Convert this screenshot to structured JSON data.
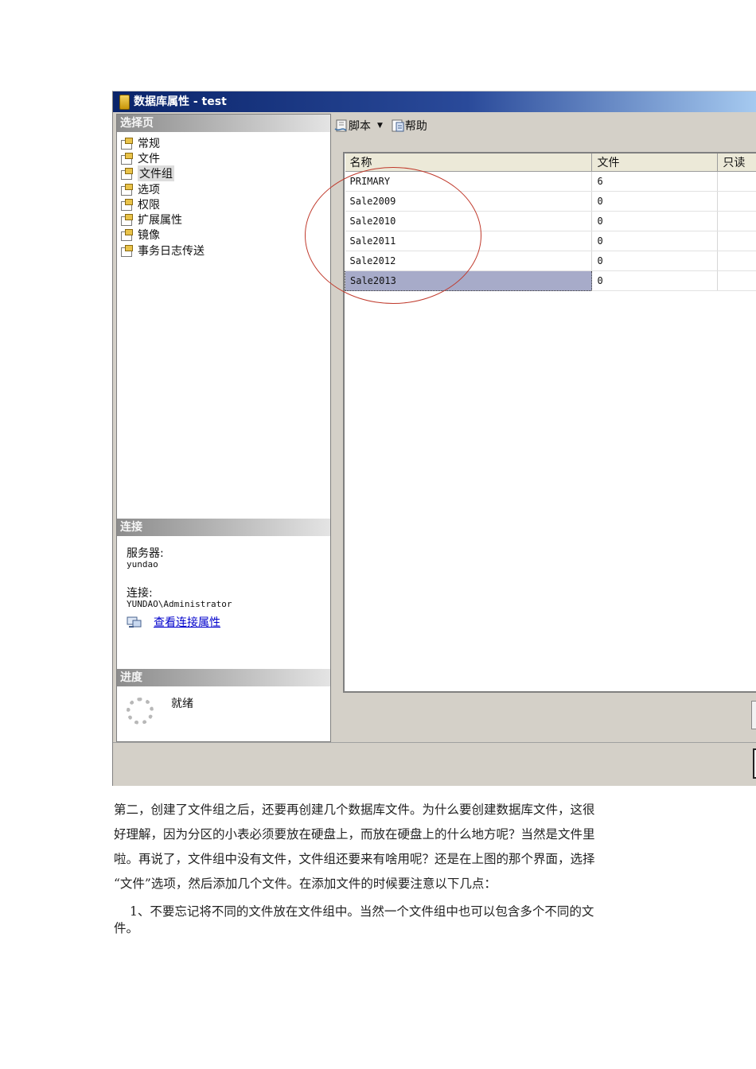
{
  "window": {
    "title": "数据库属性 - test"
  },
  "left_pane": {
    "select_page_header": "选择页",
    "nav_items": [
      {
        "label": "常规"
      },
      {
        "label": "文件"
      },
      {
        "label": "文件组",
        "selected": true
      },
      {
        "label": "选项"
      },
      {
        "label": "权限"
      },
      {
        "label": "扩展属性"
      },
      {
        "label": "镜像"
      },
      {
        "label": "事务日志传送"
      }
    ],
    "connection_header": "连接",
    "server_label": "服务器:",
    "server_value": "yundao",
    "connection_label": "连接:",
    "connection_value": "YUNDAO\\Administrator",
    "view_connection_link": "查看连接属性",
    "progress_header": "进度",
    "progress_status": "就绪"
  },
  "toolbar": {
    "script_label": "脚本",
    "help_label": "帮助"
  },
  "grid": {
    "columns": [
      "名称",
      "文件",
      "只读"
    ],
    "rows": [
      {
        "name": "PRIMARY",
        "files": "6"
      },
      {
        "name": "Sale2009",
        "files": "0"
      },
      {
        "name": "Sale2010",
        "files": "0"
      },
      {
        "name": "Sale2011",
        "files": "0"
      },
      {
        "name": "Sale2012",
        "files": "0"
      },
      {
        "name": "Sale2013",
        "files": "0",
        "selected": true
      }
    ]
  },
  "annotation_color": "#c0392b",
  "body_text": {
    "para1_lines": [
      "第二，创建了文件组之后，还要再创建几个数据库文件。为什么要创建数据库文件，这很",
      "好理解，因为分区的小表必须要放在硬盘上，而放在硬盘上的什么地方呢？当然是文件里",
      "啦。再说了，文件组中没有文件，文件组还要来有啥用呢？还是在上图的那个界面，选择",
      "“文件”选项，然后添加几个文件。在添加文件的时候要注意以下几点："
    ],
    "para2_lines": [
      "1、不要忘记将不同的文件放在文件组中。当然一个文件组中也可以包含多个不同的文",
      "件。"
    ]
  }
}
